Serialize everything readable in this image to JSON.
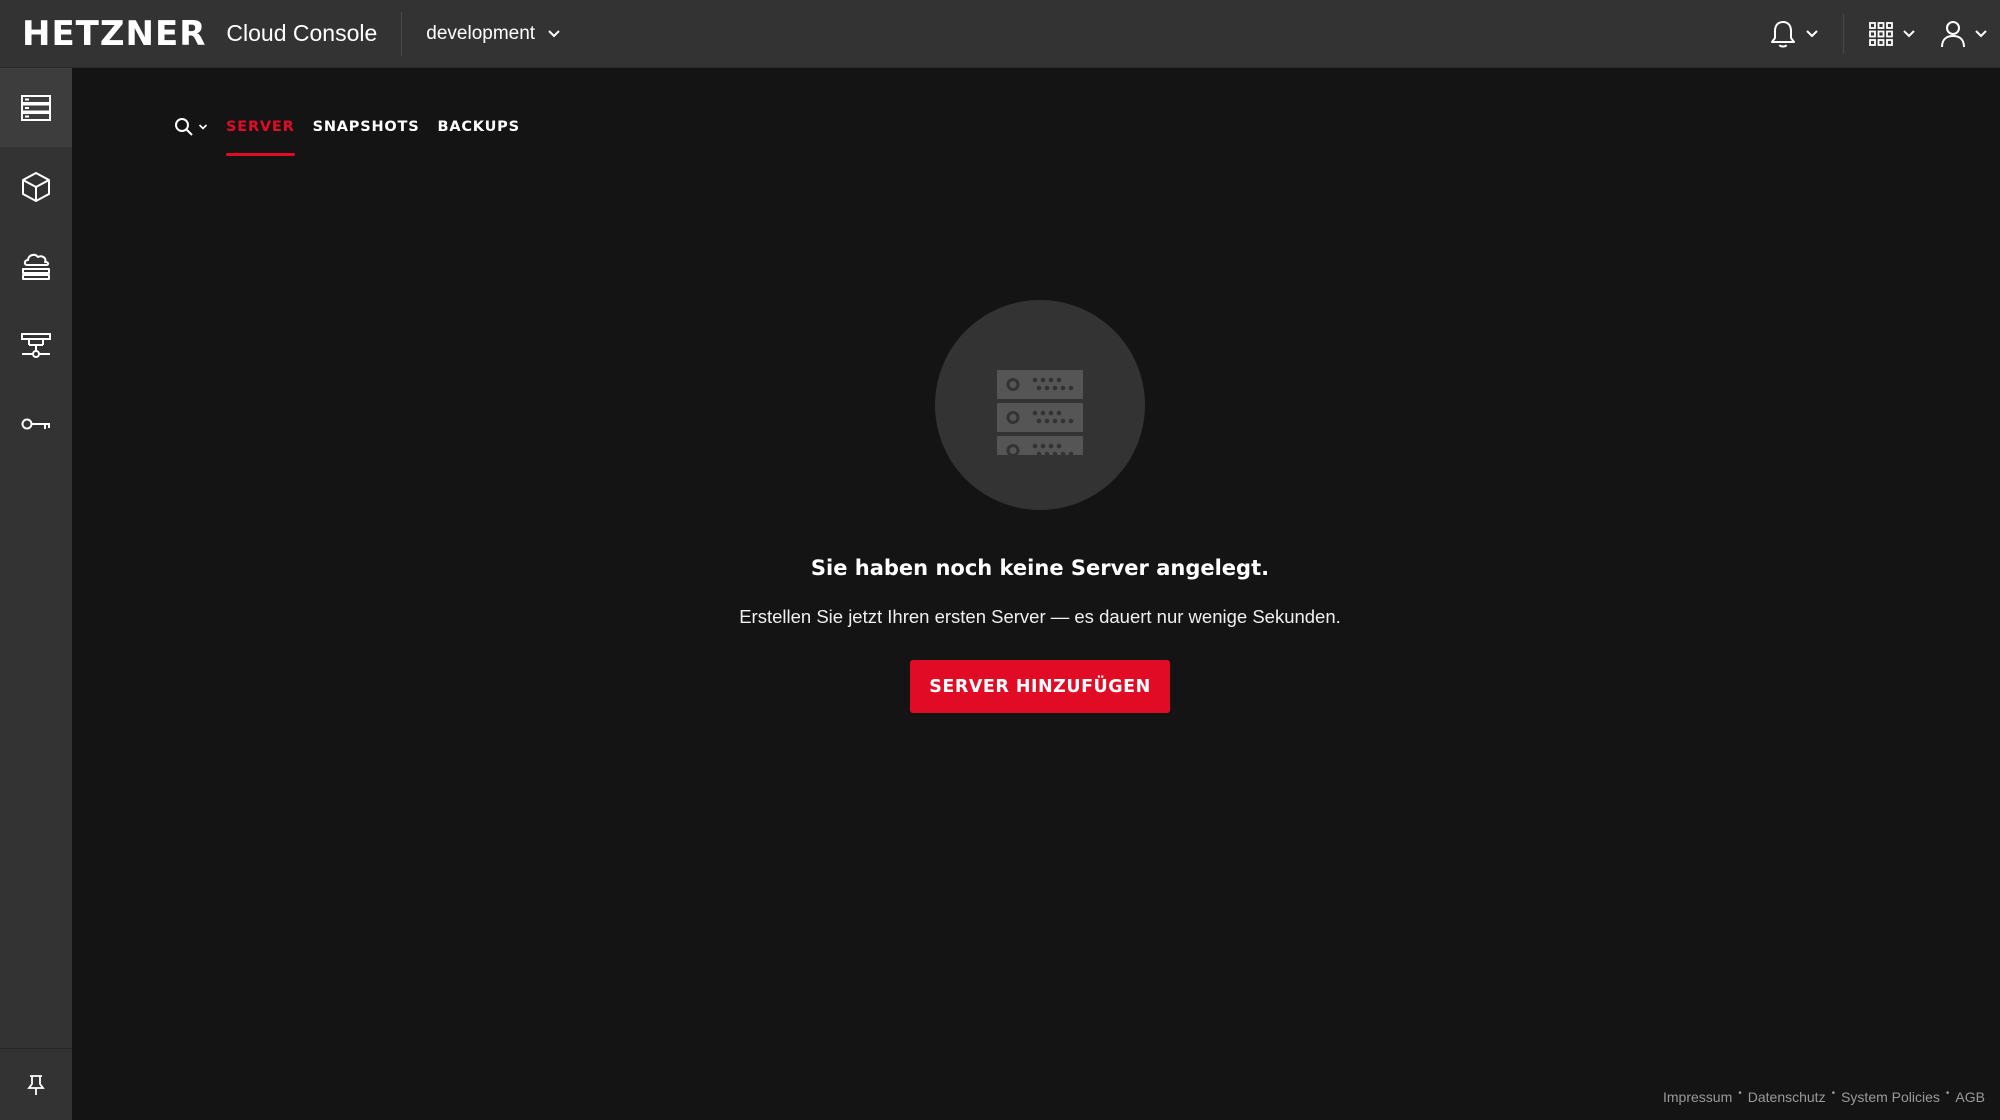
{
  "header": {
    "logo_text": "HETZNER",
    "app_name": "Cloud Console",
    "project": "development"
  },
  "sidebar": {
    "items": [
      {
        "name": "servers",
        "icon": "server-rack-icon"
      },
      {
        "name": "volumes",
        "icon": "cube-icon"
      },
      {
        "name": "load-balancers",
        "icon": "cloud-network-icon"
      },
      {
        "name": "networks",
        "icon": "network-icon"
      },
      {
        "name": "security",
        "icon": "key-icon"
      }
    ],
    "pin_icon": "pin-icon"
  },
  "tabs": [
    {
      "label": "SERVER",
      "active": true
    },
    {
      "label": "SNAPSHOTS",
      "active": false
    },
    {
      "label": "BACKUPS",
      "active": false
    }
  ],
  "empty_state": {
    "title": "Sie haben noch keine Server angelegt.",
    "subtitle": "Erstellen Sie jetzt Ihren ersten Server — es dauert nur wenige Sekunden.",
    "button_label": "SERVER HINZUFÜGEN"
  },
  "footer": {
    "links": [
      "Impressum",
      "Datenschutz",
      "System Policies",
      "AGB"
    ]
  },
  "colors": {
    "accent": "#e10b26",
    "background": "#141414",
    "panel": "#333333"
  }
}
